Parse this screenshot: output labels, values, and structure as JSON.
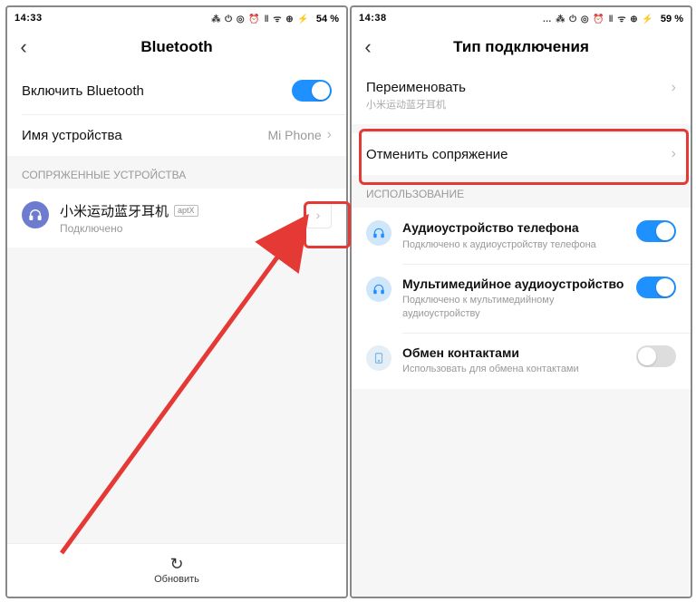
{
  "left": {
    "status": {
      "time": "14:33",
      "icons": "⁂ ⏻ ◎ ⏰ ‖ ᯤ ⊕ ⚡",
      "battery": "54 %"
    },
    "title": "Bluetooth",
    "enable_label": "Включить Bluetooth",
    "device_name_label": "Имя устройства",
    "device_name_value": "Mi Phone",
    "paired_section": "СОПРЯЖЕННЫЕ УСТРОЙСТВА",
    "device": {
      "name": "小米运动蓝牙耳机",
      "badge": "aptX",
      "status": "Подключено"
    },
    "refresh": "Обновить"
  },
  "right": {
    "status": {
      "time": "14:38",
      "icons": "… ⁂ ⏻ ◎ ⏰ ‖ ᯤ ⊕ ⚡",
      "battery": "59 %"
    },
    "title": "Тип подключения",
    "rename_label": "Переименовать",
    "rename_sub": "小米运动蓝牙耳机",
    "unpair_label": "Отменить сопряжение",
    "usage_section": "ИСПОЛЬЗОВАНИЕ",
    "usage": [
      {
        "title": "Аудиоустройство телефона",
        "sub": "Подключено к аудиоустройству телефона",
        "on": true,
        "enabled": true
      },
      {
        "title": "Мультимедийное аудиоустройство",
        "sub": "Подключено к мультимедийному аудиоустройству",
        "on": true,
        "enabled": true
      },
      {
        "title": "Обмен контактами",
        "sub": "Использовать для обмена контактами",
        "on": false,
        "enabled": false
      }
    ]
  }
}
